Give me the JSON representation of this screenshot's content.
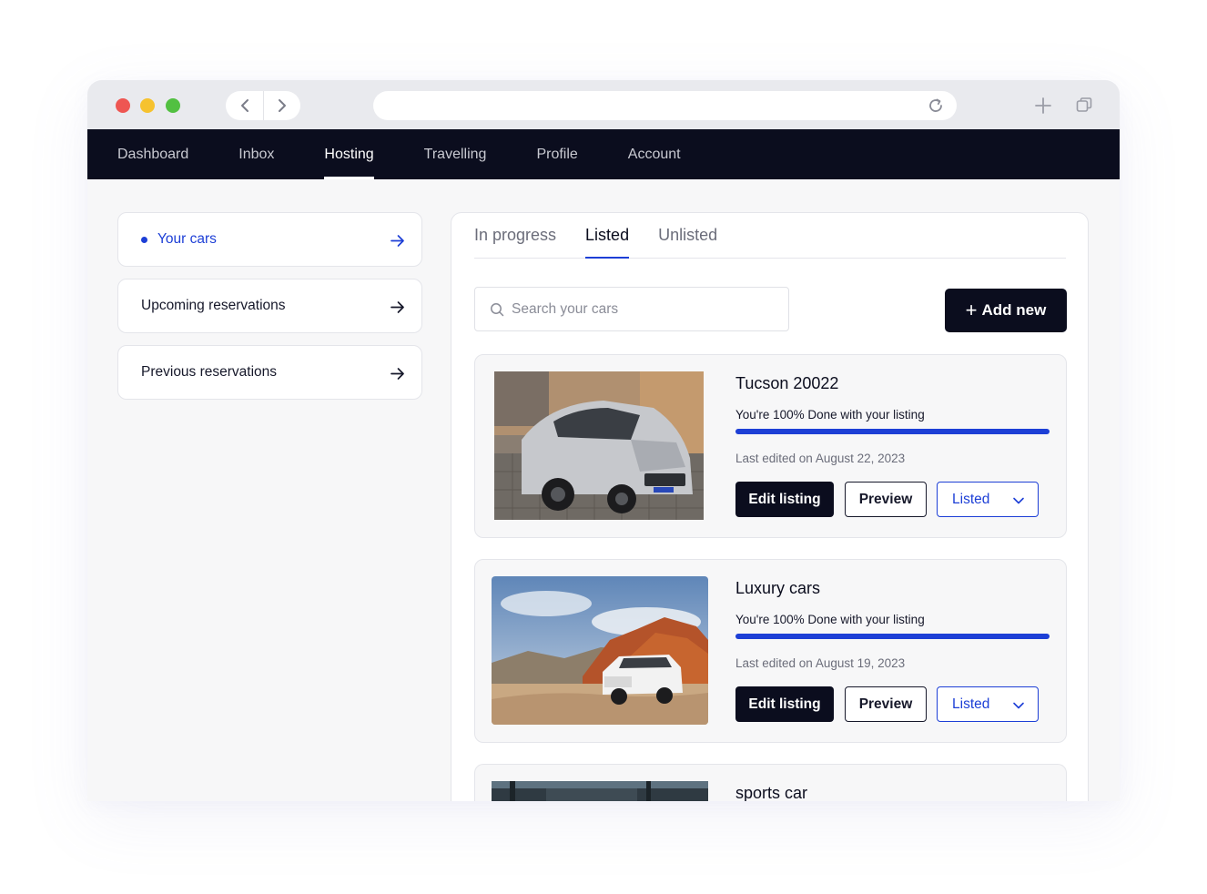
{
  "nav": {
    "items": [
      {
        "label": "Dashboard"
      },
      {
        "label": "Inbox"
      },
      {
        "label": "Hosting",
        "active": true
      },
      {
        "label": "Travelling"
      },
      {
        "label": "Profile"
      },
      {
        "label": "Account"
      }
    ]
  },
  "sidebar": {
    "items": [
      {
        "label": "Your cars",
        "active": true
      },
      {
        "label": "Upcoming reservations"
      },
      {
        "label": "Previous reservations"
      }
    ]
  },
  "tabs": [
    {
      "label": "In progress"
    },
    {
      "label": "Listed",
      "active": true
    },
    {
      "label": "Unlisted"
    }
  ],
  "search": {
    "placeholder": "Search your cars"
  },
  "add_button": {
    "label": "Add new"
  },
  "cars": [
    {
      "title": "Tucson 20022",
      "progress_text": "You're 100% Done with your listing",
      "progress": 1.0,
      "edited": "Last edited on August 22, 2023",
      "edit_label": "Edit listing",
      "preview_label": "Preview",
      "status_label": "Listed"
    },
    {
      "title": "Luxury cars",
      "progress_text": "You're 100% Done with your listing",
      "progress": 1.0,
      "edited": "Last edited on August 19, 2023",
      "edit_label": "Edit listing",
      "preview_label": "Preview",
      "status_label": "Listed"
    },
    {
      "title": "sports car"
    }
  ],
  "colors": {
    "accent": "#1d3fd6",
    "nav_bg": "#0b0d1e"
  }
}
